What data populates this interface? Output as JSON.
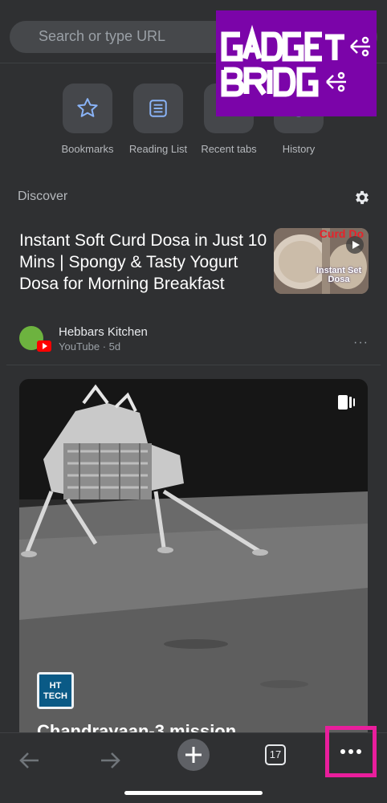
{
  "search": {
    "placeholder": "Search or type URL"
  },
  "quick_links": [
    {
      "label": "Bookmarks",
      "icon": "star-icon"
    },
    {
      "label": "Reading List",
      "icon": "list-icon"
    },
    {
      "label": "Recent tabs",
      "icon": "recent-tabs-icon"
    },
    {
      "label": "History",
      "icon": "history-icon"
    }
  ],
  "watermark": {
    "text": "GADGET BRIDGE",
    "color": "#7b04a9"
  },
  "discover": {
    "label": "Discover"
  },
  "article": {
    "title": "Instant Soft Curd Dosa in Just 10 Mins | Spongy & Tasty Yogurt Dosa for Morning Breakfast",
    "thumbnail_text_top": "Curd Do",
    "thumbnail_text_bottom": "Instant Set Dosa",
    "publisher": "Hebbars Kitchen",
    "meta": "YouTube · 5d",
    "more": "···"
  },
  "card": {
    "logo_text": "HT TECH",
    "title": "Chandrayaan-3 mission"
  },
  "toolbar": {
    "tab_count": "17",
    "menu_highlight_color": "#e91e9c"
  }
}
